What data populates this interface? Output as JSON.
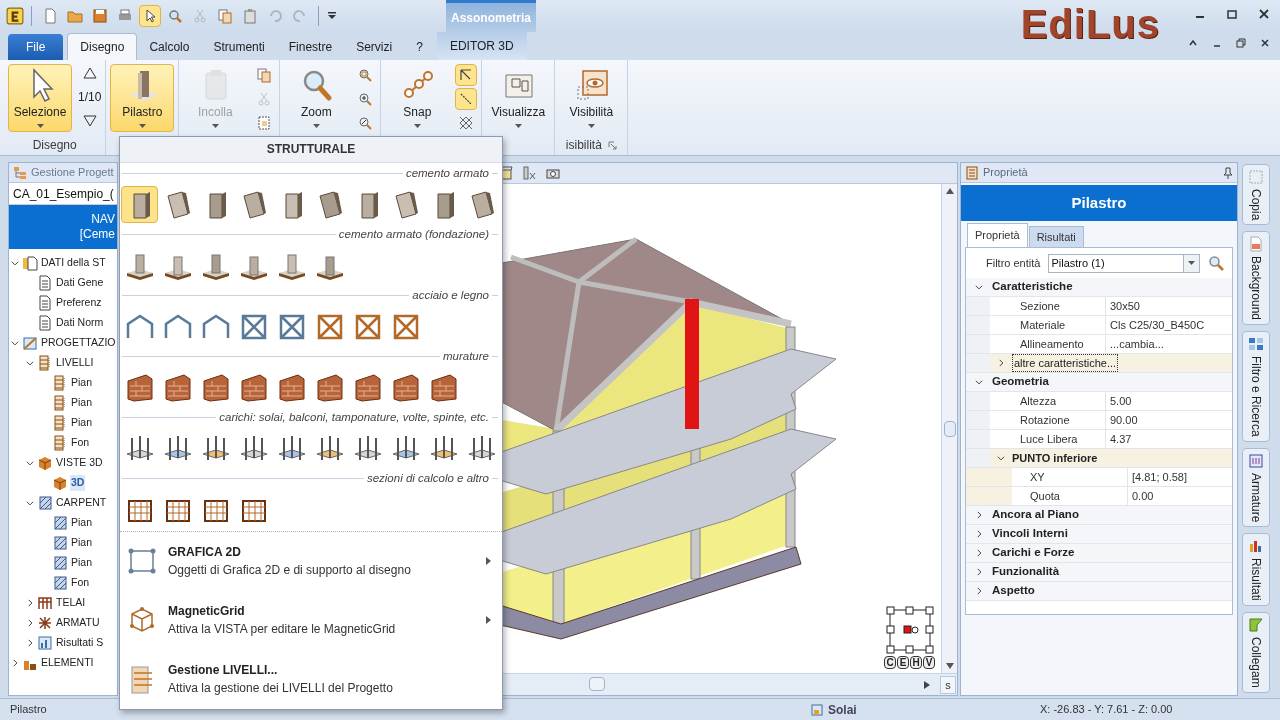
{
  "quick_access": [
    {
      "active": false,
      "disabled": false
    },
    {
      "active": false,
      "disabled": false
    },
    {
      "active": false,
      "disabled": false
    },
    {
      "active": false,
      "disabled": false
    },
    {
      "active": true,
      "disabled": false
    },
    {
      "active": false,
      "disabled": false
    },
    {
      "active": false,
      "disabled": true
    },
    {
      "active": false,
      "disabled": false
    },
    {
      "active": false,
      "disabled": false
    },
    {
      "active": false,
      "disabled": true
    },
    {
      "active": false,
      "disabled": true
    }
  ],
  "contextual_header": "Assonometria",
  "logo": "EdiLus",
  "tabs": [
    {
      "label": "File",
      "kind": "file",
      "selected": false
    },
    {
      "label": "Disegno",
      "kind": "tab",
      "selected": true
    },
    {
      "label": "Calcolo",
      "kind": "tab",
      "selected": false
    },
    {
      "label": "Strumenti",
      "kind": "tab",
      "selected": false
    },
    {
      "label": "Finestre",
      "kind": "tab",
      "selected": false
    },
    {
      "label": "Servizi",
      "kind": "tab",
      "selected": false
    },
    {
      "label": "?",
      "kind": "tab",
      "selected": false
    },
    {
      "label": "EDITOR 3D",
      "kind": "contextual",
      "selected": false
    }
  ],
  "ribbon": {
    "groups": [
      {
        "label": "Disegno",
        "items": [
          {
            "kind": "large",
            "label": "Selezione",
            "active": true,
            "disabled": false
          },
          {
            "kind": "counter",
            "label": "1/10"
          }
        ]
      },
      {
        "items": [
          {
            "kind": "large",
            "label": "Pilastro",
            "active": true,
            "disabled": false
          }
        ]
      },
      {
        "items": [
          {
            "kind": "large",
            "label": "Incolla",
            "active": false,
            "disabled": true
          },
          {
            "kind": "small",
            "tools": [
              {
                "active": false,
                "disabled": false
              },
              {
                "active": false,
                "disabled": true
              },
              {
                "active": false,
                "disabled": false
              }
            ]
          }
        ]
      },
      {
        "items": [
          {
            "kind": "large",
            "label": "Zoom",
            "active": false,
            "disabled": false
          },
          {
            "kind": "small",
            "tools": [
              {
                "active": false,
                "disabled": false
              },
              {
                "active": false,
                "disabled": false
              },
              {
                "active": false,
                "disabled": false
              }
            ]
          }
        ]
      },
      {
        "items": [
          {
            "kind": "large",
            "label": "Snap",
            "active": false,
            "disabled": false
          },
          {
            "kind": "small",
            "tools": [
              {
                "active": true,
                "disabled": false
              },
              {
                "active": true,
                "disabled": false
              },
              {
                "active": false,
                "disabled": false
              }
            ]
          }
        ]
      },
      {
        "items": [
          {
            "kind": "large",
            "label": "Visualizza",
            "active": false,
            "disabled": false
          }
        ]
      },
      {
        "label": "isibilità",
        "items": [
          {
            "kind": "large",
            "label": "Visibilità",
            "active": false,
            "disabled": false
          }
        ]
      }
    ]
  },
  "project_panel": {
    "title": "Gestione Progett",
    "project": "CA_01_Esempio_(",
    "banner": [
      "NAV",
      "[Ceme"
    ],
    "tree": [
      {
        "label": "DATI della ST",
        "kind": "data",
        "expanded": true,
        "selected": false,
        "children": [
          {
            "label": "Dati Gene",
            "kind": "doc",
            "selected": false
          },
          {
            "label": "Preferenz",
            "kind": "doc",
            "selected": false
          },
          {
            "label": "Dati Norm",
            "kind": "doc",
            "selected": false
          }
        ]
      },
      {
        "label": "PROGETTAZIO",
        "kind": "design",
        "expanded": true,
        "selected": false,
        "children": [
          {
            "label": "LIVELLI",
            "kind": "levels",
            "expanded": true,
            "selected": false,
            "children": [
              {
                "label": "Pian",
                "kind": "level",
                "selected": false
              },
              {
                "label": "Pian",
                "kind": "level",
                "selected": false
              },
              {
                "label": "Pian",
                "kind": "level",
                "selected": false
              },
              {
                "label": "Fon",
                "kind": "level",
                "selected": false
              }
            ]
          },
          {
            "label": "VISTE 3D",
            "kind": "view3d",
            "expanded": true,
            "selected": false,
            "children": [
              {
                "label": "3D",
                "kind": "view3d",
                "selected": true
              }
            ]
          },
          {
            "label": "CARPENT",
            "kind": "plan",
            "expanded": true,
            "selected": false,
            "children": [
              {
                "label": "Pian",
                "kind": "plan",
                "selected": false
              },
              {
                "label": "Pian",
                "kind": "plan",
                "selected": false
              },
              {
                "label": "Pian",
                "kind": "plan",
                "selected": false
              },
              {
                "label": "Fon",
                "kind": "plan",
                "selected": false
              }
            ]
          },
          {
            "label": "TELAI",
            "kind": "frames",
            "expanded": false,
            "selected": false
          },
          {
            "label": "ARMATU",
            "kind": "rebar",
            "expanded": false,
            "selected": false
          },
          {
            "label": "Risultati S",
            "kind": "results",
            "expanded": false,
            "selected": false
          }
        ]
      },
      {
        "label": "ELEMENTI",
        "kind": "elements",
        "expanded": false,
        "selected": false
      }
    ]
  },
  "menu": {
    "title": "STRUTTURALE",
    "sections": [
      {
        "title": "cemento armato",
        "tools": [
          {
            "selected": true
          },
          {
            "selected": false
          },
          {
            "selected": false
          },
          {
            "selected": false
          },
          {
            "selected": false
          },
          {
            "selected": false
          },
          {
            "selected": false
          },
          {
            "selected": false
          },
          {
            "selected": false
          },
          {
            "selected": false
          }
        ]
      },
      {
        "title": "cemento armato (fondazione)",
        "tools": [
          {
            "selected": false
          },
          {
            "selected": false
          },
          {
            "selected": false
          },
          {
            "selected": false
          },
          {
            "selected": false
          },
          {
            "selected": false
          }
        ]
      },
      {
        "title": "acciaio e legno",
        "tools": [
          {
            "selected": false
          },
          {
            "selected": false
          },
          {
            "selected": false
          },
          {
            "selected": false
          },
          {
            "selected": false
          },
          {
            "selected": false
          },
          {
            "selected": false
          },
          {
            "selected": false
          }
        ]
      },
      {
        "title": "murature",
        "tools": [
          {
            "selected": false
          },
          {
            "selected": false
          },
          {
            "selected": false
          },
          {
            "selected": false
          },
          {
            "selected": false
          },
          {
            "selected": false
          },
          {
            "selected": false
          },
          {
            "selected": false
          },
          {
            "selected": false
          }
        ]
      },
      {
        "title": "carichi: solai, balconi, tamponature, volte, spinte, etc.",
        "tools": [
          {
            "selected": false
          },
          {
            "selected": false
          },
          {
            "selected": false
          },
          {
            "selected": false
          },
          {
            "selected": false
          },
          {
            "selected": false
          },
          {
            "selected": false
          },
          {
            "selected": false
          },
          {
            "selected": false
          },
          {
            "selected": false
          }
        ]
      },
      {
        "title": "sezioni di calcolo e altro",
        "tools": [
          {
            "selected": false
          },
          {
            "selected": false
          },
          {
            "selected": false
          },
          {
            "selected": false
          }
        ]
      }
    ],
    "items": [
      {
        "title": "GRAFICA 2D",
        "description": "Oggetti di Grafica 2D e di supporto al disegno",
        "submenu": true
      },
      {
        "title": "MagneticGrid",
        "description": "Attiva la VISTA per editare le MagneticGrid",
        "submenu": true
      },
      {
        "title": "Gestione LIVELLI...",
        "description": "Attiva la gestione dei LIVELLI del Progetto",
        "submenu": false
      }
    ]
  },
  "viewport": {
    "view_buttons": [
      "C",
      "E",
      "H",
      "V"
    ],
    "scroll_button": "s"
  },
  "properties": {
    "title": "Proprietà",
    "entity": "Pilastro",
    "tabs": [
      {
        "label": "Proprietà",
        "selected": true
      },
      {
        "label": "Risultati",
        "selected": false
      }
    ],
    "filter_label": "Filtro entità",
    "filter_value": "Pilastro (1)",
    "sections": [
      {
        "title": "Caratteristiche",
        "expanded": true,
        "rows": [
          {
            "kind": "property",
            "label": "Sezione",
            "value": "30x50"
          },
          {
            "kind": "property",
            "label": "Materiale",
            "value": "Cls C25/30_B450C"
          },
          {
            "kind": "property",
            "label": "Allineamento",
            "value": "...cambia..."
          },
          {
            "kind": "group",
            "label": "altre caratteristiche...",
            "expanded": false,
            "focused": true
          }
        ]
      },
      {
        "title": "Geometria",
        "expanded": true,
        "rows": [
          {
            "kind": "property",
            "label": "Altezza",
            "value": "5.00"
          },
          {
            "kind": "property",
            "label": "Rotazione",
            "value": "90.00"
          },
          {
            "kind": "property",
            "label": "Luce Libera",
            "value": "4.37"
          },
          {
            "kind": "group",
            "label": "PUNTO inferiore",
            "expanded": true,
            "focused": false,
            "rows": [
              {
                "kind": "property",
                "label": "XY",
                "value": "[4.81; 0.58]"
              },
              {
                "kind": "property",
                "label": "Quota",
                "value": "0.00"
              }
            ]
          }
        ]
      },
      {
        "title": "Ancora al Piano",
        "expanded": false
      },
      {
        "title": "Vincoli Interni",
        "expanded": false
      },
      {
        "title": "Carichi e Forze",
        "expanded": false
      },
      {
        "title": "Funzionalità",
        "expanded": false
      },
      {
        "title": "Aspetto",
        "expanded": false
      }
    ]
  },
  "side_tabs": [
    "Copia",
    "Background",
    "Filtro e Ricerca",
    "Armature",
    "Risultati",
    "Collegam"
  ],
  "status_bar": {
    "left": "Pilastro",
    "center": "Solai",
    "coordinates": "X: -26.83 - Y: 7.61 - Z: 0.00"
  }
}
